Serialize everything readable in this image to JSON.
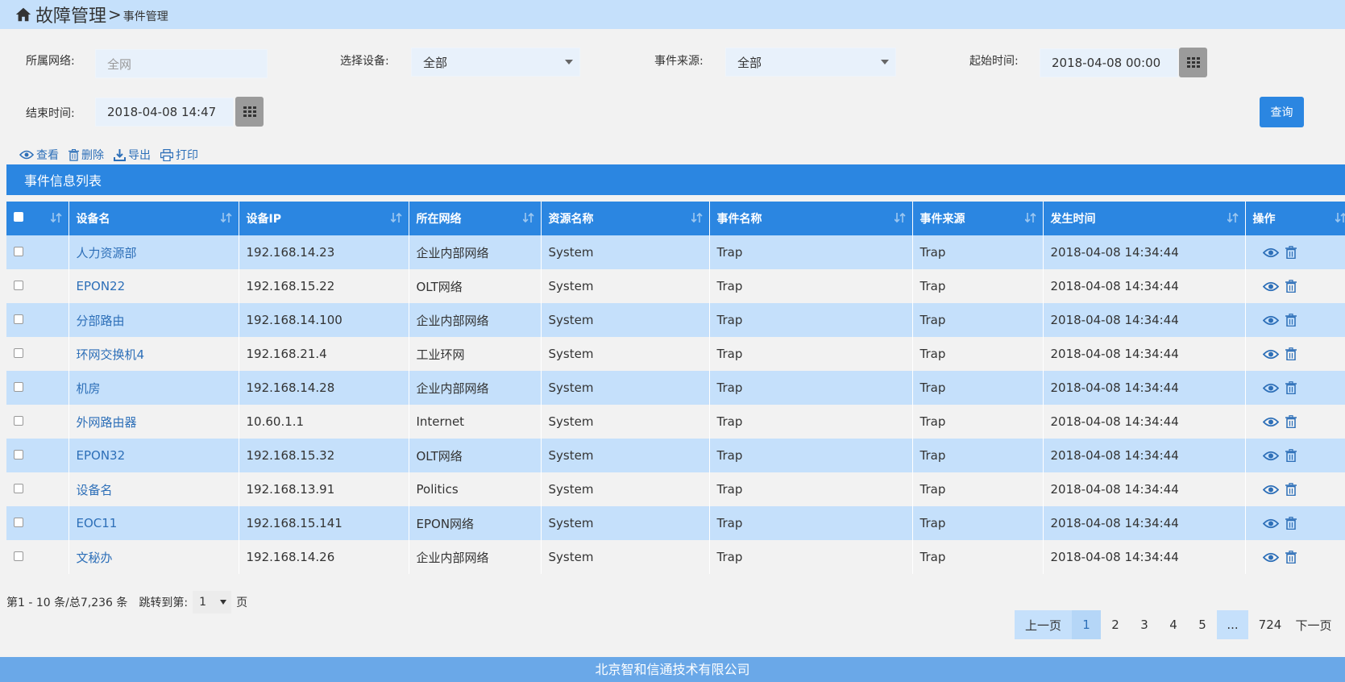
{
  "header": {
    "title": "故障管理",
    "separator": ">",
    "subtitle": "事件管理"
  },
  "filters": {
    "network_label": "所属网络:",
    "network_placeholder": "全网",
    "device_label": "选择设备:",
    "device_value": "全部",
    "source_label": "事件来源:",
    "source_value": "全部",
    "start_label": "起始时间:",
    "start_value": "2018-04-08 00:00",
    "end_label": "结束时间:",
    "end_value": "2018-04-08 14:47",
    "query_label": "查询"
  },
  "toolbar": {
    "view": "查看",
    "delete": "删除",
    "export": "导出",
    "print": "打印"
  },
  "list_title": "事件信息列表",
  "columns": [
    "设备名",
    "设备IP",
    "所在网络",
    "资源名称",
    "事件名称",
    "事件来源",
    "发生时间",
    "操作"
  ],
  "rows": [
    {
      "name": "人力资源部",
      "ip": "192.168.14.23",
      "network": "企业内部网络",
      "resource": "System",
      "event": "Trap",
      "source": "Trap",
      "time": "2018-04-08 14:34:44"
    },
    {
      "name": "EPON22",
      "ip": "192.168.15.22",
      "network": "OLT网络",
      "resource": "System",
      "event": "Trap",
      "source": "Trap",
      "time": "2018-04-08 14:34:44"
    },
    {
      "name": "分部路由",
      "ip": "192.168.14.100",
      "network": "企业内部网络",
      "resource": "System",
      "event": "Trap",
      "source": "Trap",
      "time": "2018-04-08 14:34:44"
    },
    {
      "name": "环网交换机4",
      "ip": "192.168.21.4",
      "network": "工业环网",
      "resource": "System",
      "event": "Trap",
      "source": "Trap",
      "time": "2018-04-08 14:34:44"
    },
    {
      "name": "机房",
      "ip": "192.168.14.28",
      "network": "企业内部网络",
      "resource": "System",
      "event": "Trap",
      "source": "Trap",
      "time": "2018-04-08 14:34:44"
    },
    {
      "name": "外网路由器",
      "ip": "10.60.1.1",
      "network": "Internet",
      "resource": "System",
      "event": "Trap",
      "source": "Trap",
      "time": "2018-04-08 14:34:44"
    },
    {
      "name": "EPON32",
      "ip": "192.168.15.32",
      "network": "OLT网络",
      "resource": "System",
      "event": "Trap",
      "source": "Trap",
      "time": "2018-04-08 14:34:44"
    },
    {
      "name": "设备名",
      "ip": "192.168.13.91",
      "network": "Politics",
      "resource": "System",
      "event": "Trap",
      "source": "Trap",
      "time": "2018-04-08 14:34:44"
    },
    {
      "name": "EOC11",
      "ip": "192.168.15.141",
      "network": "EPON网络",
      "resource": "System",
      "event": "Trap",
      "source": "Trap",
      "time": "2018-04-08 14:34:44"
    },
    {
      "name": "文秘办",
      "ip": "192.168.14.26",
      "network": "企业内部网络",
      "resource": "System",
      "event": "Trap",
      "source": "Trap",
      "time": "2018-04-08 14:34:44"
    }
  ],
  "pagination": {
    "info": "第1 - 10 条/总7,236 条",
    "jump_label": "跳转到第:",
    "jump_value": "1",
    "jump_suffix": "页",
    "prev": "上一页",
    "pages": [
      "1",
      "2",
      "3",
      "4",
      "5",
      "...",
      "724"
    ],
    "current": "1",
    "next": "下一页"
  },
  "footer": "北京智和信通技术有限公司",
  "colors": {
    "accent": "#2b86e1",
    "row_highlight": "#c5e0fb",
    "link": "#2d6fb8"
  }
}
